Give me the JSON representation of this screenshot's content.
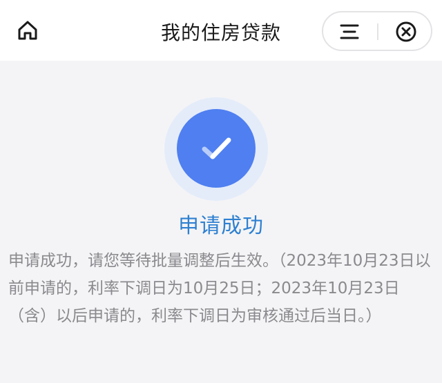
{
  "header": {
    "title": "我的住房贷款",
    "home_icon": "home-icon",
    "menu_icon": "menu-icon",
    "close_icon": "close-circle-icon"
  },
  "result": {
    "icon": "check-icon",
    "status_text": "申请成功",
    "description": "申请成功，请您等待批量调整后生效。（2023年10月23日以前申请的，利率下调日为10月25日；2023年10月23日（含）以后申请的，利率下调日为审核通过后当日。）"
  },
  "colors": {
    "accent": "#4f7ff0",
    "status_text": "#2f80d1",
    "body_text": "#8a8a8e",
    "background": "#f4f4f6"
  }
}
